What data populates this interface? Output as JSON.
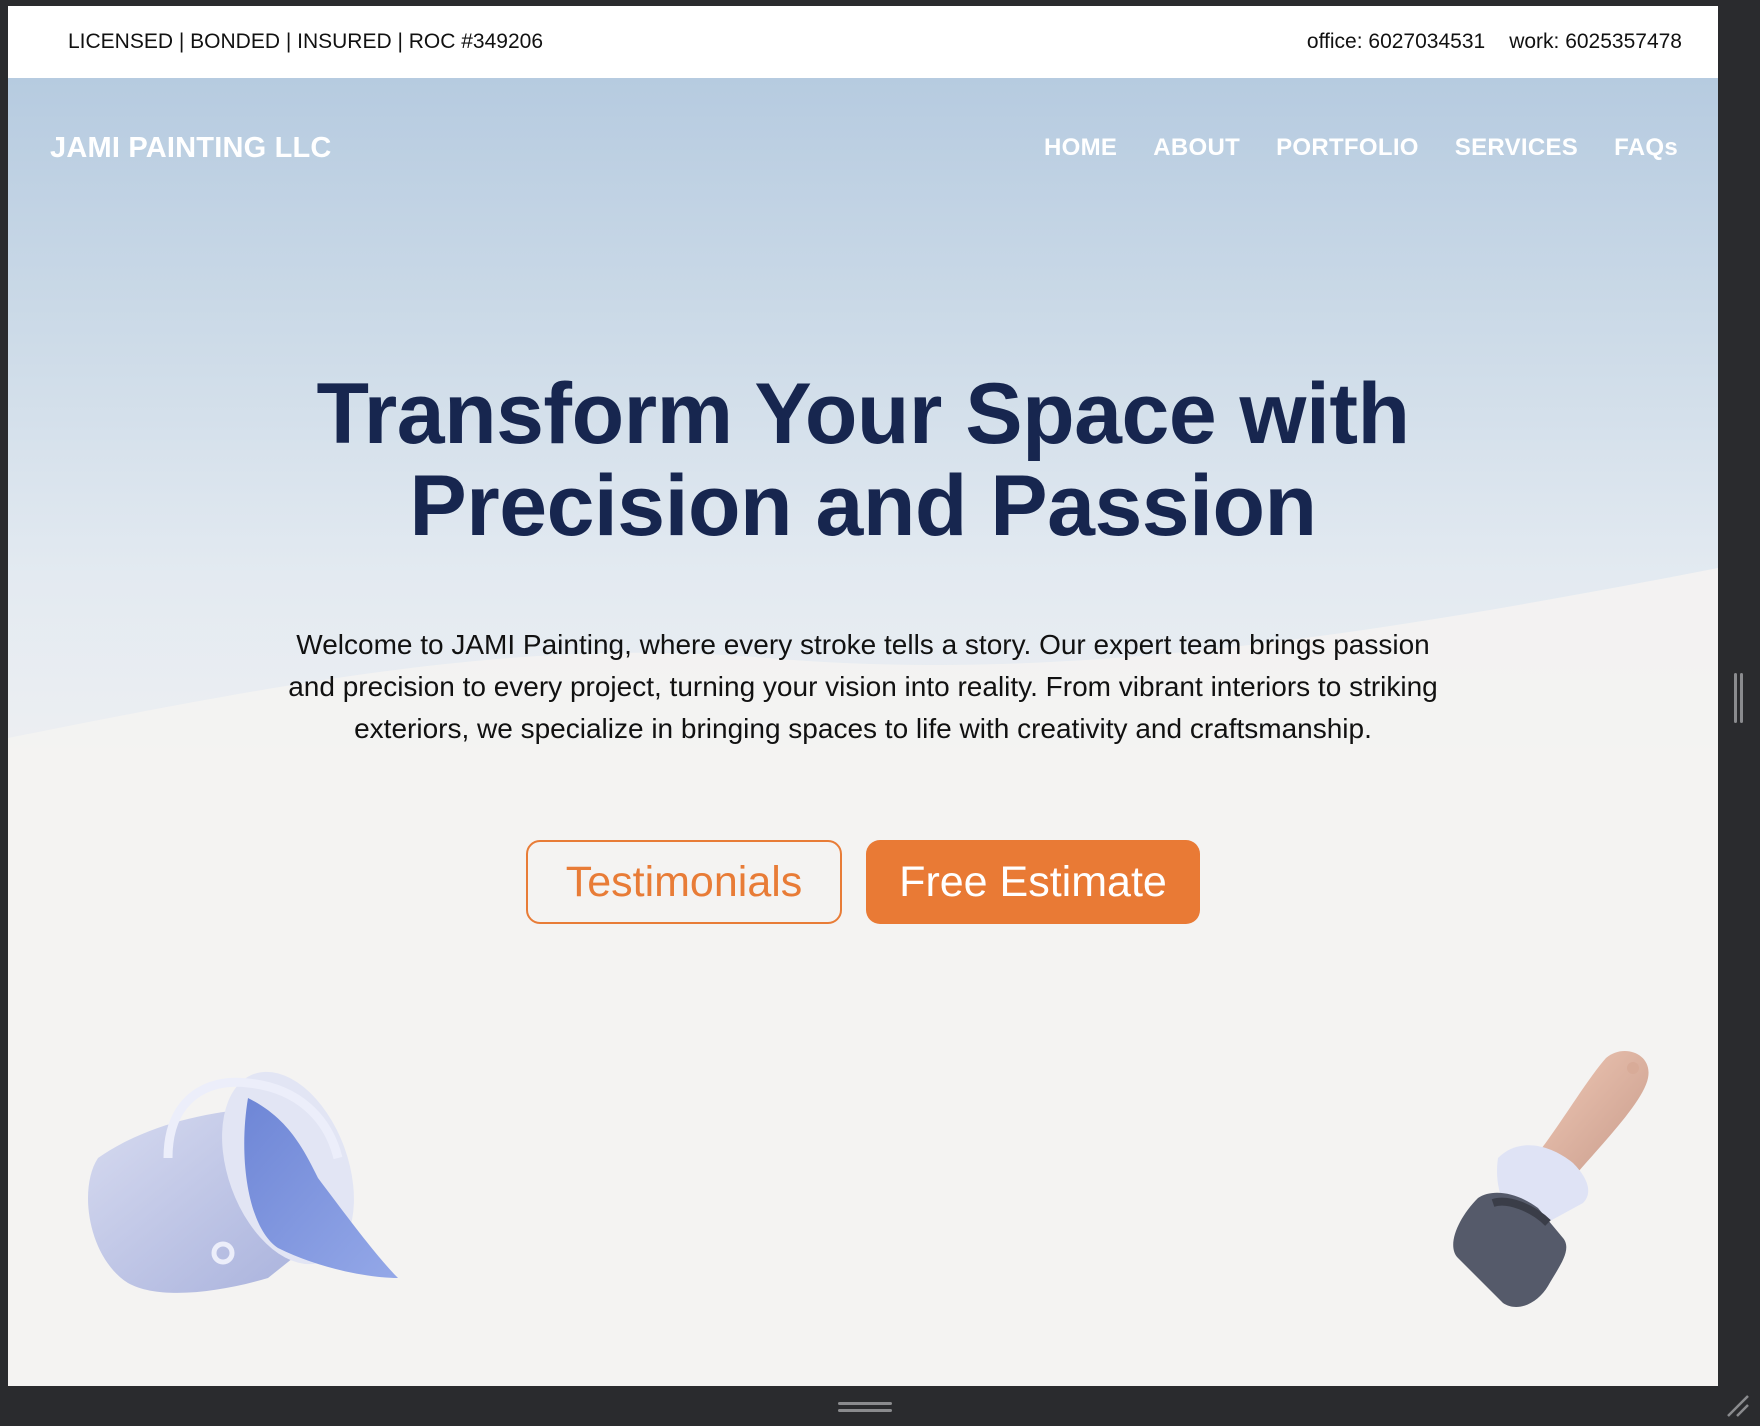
{
  "topbar": {
    "credentials": "LICENSED | BONDED | INSURED | ROC #349206",
    "office": "office: 6027034531",
    "work": "work: 6025357478"
  },
  "nav": {
    "brand": "JAMI PAINTING LLC",
    "items": [
      {
        "label": "HOME"
      },
      {
        "label": "ABOUT"
      },
      {
        "label": "PORTFOLIO"
      },
      {
        "label": "SERVICES"
      },
      {
        "label": "FAQs"
      }
    ]
  },
  "hero": {
    "headline_line1": "Transform Your Space with",
    "headline_line2": "Precision and Passion",
    "lead": "Welcome to JAMI Painting, where every stroke tells a story. Our expert team brings passion and precision to every project, turning your vision into reality. From vibrant interiors to striking exteriors, we specialize in bringing spaces to life with creativity and craftsmanship.",
    "buttons": {
      "testimonials": "Testimonials",
      "estimate": "Free Estimate"
    }
  },
  "colors": {
    "headline": "#17264f",
    "accent": "#e97a35",
    "sky_top": "#b6cbe0",
    "background": "#f2f1f0"
  },
  "icons": {
    "bucket": "paint-bucket-icon",
    "brush": "paint-brush-icon"
  }
}
